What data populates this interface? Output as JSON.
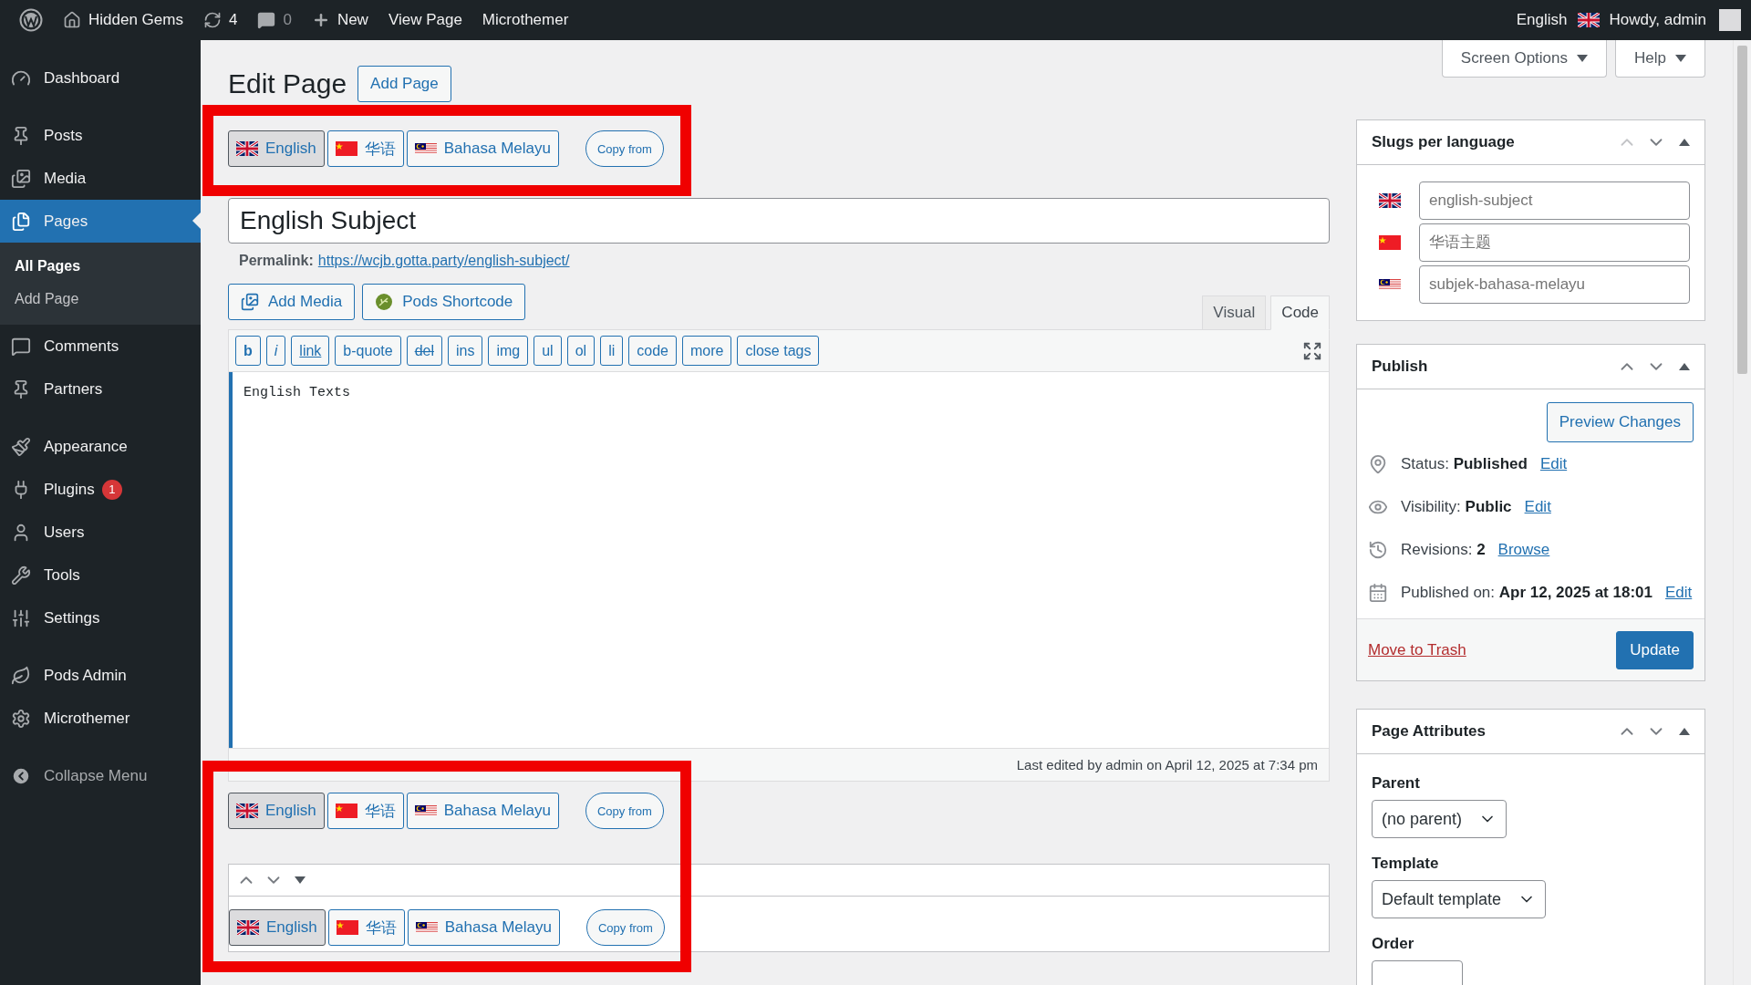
{
  "topbar": {
    "site": "Hidden Gems",
    "updates": "4",
    "comments": "0",
    "new": "New",
    "links": [
      "View Page",
      "Microthemer"
    ],
    "language": "English",
    "greeting": "Howdy, admin"
  },
  "sidebar": {
    "groups": [
      {
        "items": [
          {
            "label": "Dashboard",
            "selected": false
          }
        ]
      },
      {
        "items": [
          {
            "label": "Posts",
            "selected": false
          },
          {
            "label": "Media",
            "selected": false
          },
          {
            "label": "Pages",
            "selected": true,
            "children": [
              {
                "label": "All Pages",
                "selected": true
              },
              {
                "label": "Add Page",
                "selected": false
              }
            ]
          },
          {
            "label": "Comments",
            "selected": false
          },
          {
            "label": "Partners",
            "selected": false
          }
        ]
      },
      {
        "items": [
          {
            "label": "Appearance",
            "selected": false
          },
          {
            "label": "Plugins",
            "selected": false,
            "badge": "1"
          },
          {
            "label": "Users",
            "selected": false
          },
          {
            "label": "Tools",
            "selected": false
          },
          {
            "label": "Settings",
            "selected": false
          }
        ]
      },
      {
        "items": [
          {
            "label": "Pods Admin",
            "selected": false
          },
          {
            "label": "Microthemer",
            "selected": false
          }
        ]
      }
    ],
    "collapse": "Collapse Menu"
  },
  "screen_meta": [
    "Screen Options",
    "Help"
  ],
  "heading": {
    "title": "Edit Page",
    "action": "Add Page"
  },
  "language_switcher_top": {
    "languages": [
      {
        "label": "English",
        "selected": true
      },
      {
        "label": "华语",
        "selected": false
      },
      {
        "label": "Bahasa Melayu",
        "selected": false
      }
    ],
    "copy": "Copy from"
  },
  "title": {
    "value": "English Subject"
  },
  "permalink": {
    "label": "Permalink:",
    "url": "https://wcjb.gotta.party/english-subject/"
  },
  "media_buttons": [
    "Add Media",
    "Pods Shortcode"
  ],
  "editor_tabs": [
    {
      "label": "Visual",
      "selected": false
    },
    {
      "label": "Code",
      "selected": true
    }
  ],
  "quicktags": [
    {
      "label": "b",
      "kind": "bold"
    },
    {
      "label": "i",
      "kind": "italic"
    },
    {
      "label": "link",
      "kind": "link"
    },
    {
      "label": "b-quote",
      "kind": "plain"
    },
    {
      "label": "del",
      "kind": "strike"
    },
    {
      "label": "ins",
      "kind": "plain"
    },
    {
      "label": "img",
      "kind": "plain"
    },
    {
      "label": "ul",
      "kind": "plain"
    },
    {
      "label": "ol",
      "kind": "plain"
    },
    {
      "label": "li",
      "kind": "plain"
    },
    {
      "label": "code",
      "kind": "plain"
    },
    {
      "label": "more",
      "kind": "plain"
    },
    {
      "label": "close tags",
      "kind": "plain"
    }
  ],
  "editor": {
    "content": "English Texts",
    "status": "Last edited by admin on April 12, 2025 at 7:34 pm"
  },
  "language_switcher_bottom": {
    "languages": [
      {
        "label": "English",
        "selected": true
      },
      {
        "label": "华语",
        "selected": false
      },
      {
        "label": "Bahasa Melayu",
        "selected": false
      }
    ],
    "copy": "Copy from"
  },
  "box": {
    "up_disabled": false,
    "language_switcher": {
      "languages": [
        {
          "label": "English",
          "selected": true
        },
        {
          "label": "华语",
          "selected": false
        },
        {
          "label": "Bahasa Melayu",
          "selected": false
        }
      ],
      "copy": "Copy from"
    }
  },
  "slugs": {
    "title": "Slugs per language",
    "up_disabled": true,
    "fields": [
      {
        "placeholder": "english-subject"
      },
      {
        "placeholder": "华语主题"
      },
      {
        "placeholder": "subjek-bahasa-melayu"
      }
    ]
  },
  "publish": {
    "title": "Publish",
    "up_disabled": false,
    "preview": "Preview Changes",
    "rows": [
      {
        "text": "Status: **Published**",
        "link": "Edit"
      },
      {
        "text": "Visibility: **Public**",
        "link": "Edit"
      },
      {
        "text": "Revisions: **2**",
        "link": "Browse"
      },
      {
        "text": "Published on: **Apr 12, 2025 at 18:01**",
        "link": "Edit"
      }
    ],
    "trash": "Move to Trash",
    "update": "Update"
  },
  "attributes": {
    "title": "Page Attributes",
    "up_disabled": false,
    "parent_label": "Parent",
    "parent": "(no parent)",
    "template_label": "Template",
    "template": "Default template",
    "order_label": "Order"
  }
}
